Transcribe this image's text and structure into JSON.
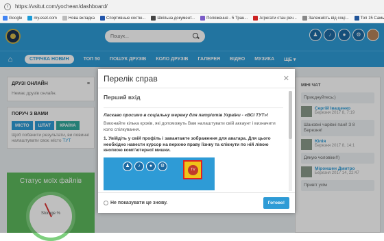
{
  "browser": {
    "url": "https://vsitut.com/yochean/dashboard/",
    "bookmarks": [
      {
        "label": "Google",
        "color": "#4285f4"
      },
      {
        "label": "my.eset.com",
        "color": "#1a9bd7"
      },
      {
        "label": "Нова вкладка",
        "color": "#bbb"
      },
      {
        "label": "Спортивные костю...",
        "color": "#2255aa"
      },
      {
        "label": "Шкільна документ...",
        "color": "#444"
      },
      {
        "label": "Положення - 5 Тран...",
        "color": "#7a5bc7"
      },
      {
        "label": "Агрегати стан реч...",
        "color": "#cc2222"
      },
      {
        "label": "Залежність від соці...",
        "color": "#888"
      },
      {
        "label": "Топ 15 Самые пол...",
        "color": "#225599"
      }
    ]
  },
  "header": {
    "search_placeholder": "Пошук...",
    "icons": [
      "add-user-icon",
      "bell-icon",
      "chat-icon",
      "gear-icon"
    ]
  },
  "nav": {
    "items": [
      {
        "label": "СТРІЧКА НОВИН",
        "active": true
      },
      {
        "label": "ТОП 50"
      },
      {
        "label": "ПОШУК ДРУЗІВ"
      },
      {
        "label": "КОЛО ДРУЗІВ"
      },
      {
        "label": "ГАЛЕРЕЯ"
      },
      {
        "label": "ВІДЕО"
      },
      {
        "label": "МУЗИКА"
      },
      {
        "label": "ЩЕ ▾"
      }
    ]
  },
  "left": {
    "friends_title": "ДРУЗІ ОНЛАЙН",
    "friends_empty": "Немає друзів онлайн.",
    "near_title": "ПОРУЧ З ВАМИ",
    "tags": [
      "МІСТО",
      "ШТАТ",
      "КРАЇНА"
    ],
    "near_note": "Щоб побачити результати, ви повинні налаштувати своє місто",
    "near_link": "ТУТ",
    "files_title": "Статус моїх файлів",
    "gauge_label": "Storage %"
  },
  "right": {
    "title": "МІНІ ЧАТ",
    "messages": [
      {
        "kind": "bubble",
        "text": "Приєднуйтесь:)"
      },
      {
        "kind": "user",
        "name": "Сергій Іващенко",
        "date": "Березня 2017 8, 7:19"
      },
      {
        "kind": "bubble",
        "text": "Шановні чарівні пані! З 8 Березня!"
      },
      {
        "kind": "user",
        "name": "Юлія",
        "date": "Березня 2017 8, 14:1"
      },
      {
        "kind": "bubble",
        "text": "Дякую чоловіки!!)"
      },
      {
        "kind": "user",
        "name": "Міроншен Дмитро",
        "date": "Березня 2017 14, 22:47"
      },
      {
        "kind": "bubble",
        "text": "Привіт усім"
      }
    ]
  },
  "modal": {
    "title": "Перелік справ",
    "step_title": "Перший вхід",
    "welcome": "Ласкаво просимо в соціальну мережу для патріотів України - «ВСІ ТУТ»!",
    "intro": "Виконайте кілька кроків, які допоможуть Вам налаштувати свій аккаунт і визначити коло спілкування.",
    "step1": "1. Увійдіть у свій профіль і завантажте зображення для аватара. Для цього необхідно навести курсор на верхню праву їізнку та клікнути по ній лівою кнопкою комп'ютерної мишки.",
    "demo_label": "TV",
    "dont_show": "Не показувати це знову.",
    "ready": "Готово!"
  }
}
